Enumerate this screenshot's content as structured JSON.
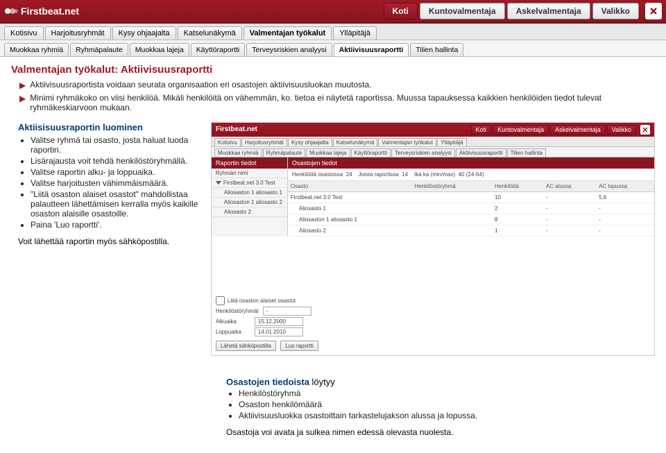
{
  "logo_text": "Firstbeat.net",
  "nav": {
    "koti": "Koti",
    "kunto": "Kuntovalmentaja",
    "askel": "Askelvalmentaja",
    "valikko": "Valikko"
  },
  "subtabs": [
    "Kotisivu",
    "Harjoitusryhmät",
    "Kysy ohjaajalta",
    "Katselunäkymä",
    "Valmentajan työkalut",
    "Ylläpitäjä"
  ],
  "subtabs_active": 4,
  "thirdtabs": [
    "Muokkaa ryhmiä",
    "Ryhmäpalaute",
    "Muokkaa lajeja",
    "Käyttöraportti",
    "Terveysriskien analyysi",
    "Aktiivisuusraportti",
    "Tilien hallinta"
  ],
  "thirdtabs_active": 5,
  "section_title": "Valmentajan työkalut: Aktiivisuusraportti",
  "intro_bullets": [
    "Aktiivisuusraportista voidaan seurata organisaation eri osastojen aktiivisuusluokan muutosta.",
    "Minimi ryhmäkoko on viisi henkilöä. Mikäli henkilöitä on vähemmän, ko. tietoa ei näytetä raportissa. Muussa tapauksessa kaikkien henkilöiden tiedot tulevat ryhmäkeskiarvoon mukaan."
  ],
  "left": {
    "title": "Aktiisisuusraportin luominen",
    "items": [
      "Valitse ryhmä tai osasto, josta haluat luoda raportin.",
      "Lisärajausta voit tehdä henkilöstöryhmällä.",
      "Valitse raportin alku- ja loppuaika.",
      "Valitse harjoitusten vähimmäismäärä.",
      "\"Liitä osaston alaiset osastot\" mahdollistaa palautteen lähettämisen kerralla myös kaikille osaston alaisille osastoille.",
      "Paina 'Luo raportti'."
    ],
    "footer": "Voit lähettää raportin myös sähköpostilla."
  },
  "mock": {
    "logo": "Firstbeat.net",
    "nav": {
      "koti": "Koti",
      "kunto": "Kuntovalmentaja",
      "askel": "Askelvalmentaja",
      "valikko": "Valikko"
    },
    "sub": [
      "Kotisivu",
      "Harjoitusryhmät",
      "Kysy ohjaajalta",
      "Katselunäkymä",
      "Valmentajan työkalut",
      "Ylläpitäjä"
    ],
    "third": [
      "Muokkaa ryhmiä",
      "Ryhmäpalaute",
      "Muokkaa lajeja",
      "Käyttöraportti",
      "Terveysriskien analyysi",
      "Aktiivisuusraportti",
      "Tilien hallinta"
    ],
    "side_header": "Raportin tiedot",
    "side_label": "Ryhmän nimi",
    "side_root": "Firstbeat.net 3.0 Test",
    "side_items": [
      "Aliosaston 1 aliosasto 1",
      "Aliosaston 1 aliosasto 2",
      "Aliosasto 2"
    ],
    "main_header": "Osastojen tiedot",
    "stats": {
      "l1": "Henkilöitä osastossa",
      "v1": "24",
      "l2": "Joista raportissa",
      "v2": "14",
      "l3": "Ikä ka (min/max)",
      "v3": "40 (24-64)"
    },
    "cols": [
      "Osasto",
      "Henkilöstöryhmä",
      "Henkilöitä",
      "AC alussa",
      "AC lopussa"
    ],
    "rows": [
      [
        "Firstbeat.net 3.0 Test",
        "",
        "10",
        "-",
        "5,6"
      ],
      [
        "Aliosasto 1",
        "",
        "2",
        "-",
        "-"
      ],
      [
        "Aliosaston 1 aliosasto 1",
        "",
        "8",
        "-",
        "-"
      ],
      [
        "Aliosasto 2",
        "",
        "1",
        "-",
        "-"
      ]
    ],
    "attach": "Liitä osaston alaiset osastot",
    "hr_label": "Henkilöstöryhmät",
    "from_l": "Alkuaika",
    "from_v": "15.12.2000",
    "to_l": "Loppuaika",
    "to_v": "14.01.2010",
    "send": "Lähetä sähköpostilla",
    "create": "Luo raportti"
  },
  "bottom": {
    "title_bold": "Osastojen tiedoista",
    "title_rest": " löytyy",
    "items": [
      "Henkilöstöryhmä",
      "Osaston henkilömäärä",
      "Aktiivisuusluokka osastoittain tarkastelujakson alussa ja lopussa."
    ],
    "footer": "Osastoja voi avata ja sulkea nimen edessä olevasta nuolesta."
  }
}
